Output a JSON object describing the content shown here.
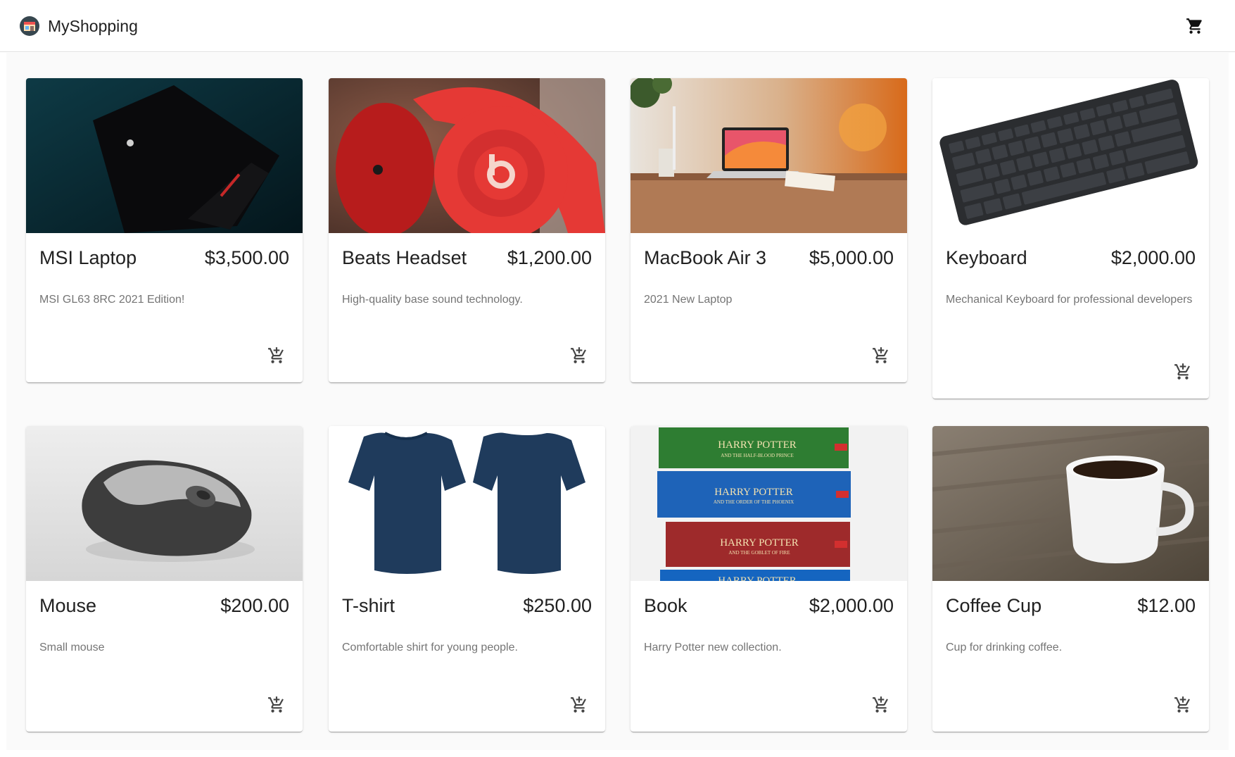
{
  "app": {
    "brand": "MyShopping",
    "logo_icon": "store-logo-icon",
    "cart_icon": "shopping-cart-icon"
  },
  "colors": {
    "background": "#fafafa",
    "appbar": "#ffffff",
    "text_primary": "#212121",
    "text_secondary": "#757575"
  },
  "products": [
    {
      "title": "MSI Laptop",
      "price": "$3,500.00",
      "description": "MSI GL63 8RC 2021 Edition!",
      "image": "laptop-image",
      "action_icon": "add-to-cart-icon"
    },
    {
      "title": "Beats Headset",
      "price": "$1,200.00",
      "description": "High-quality base sound technology.",
      "image": "headset-image",
      "action_icon": "add-to-cart-icon"
    },
    {
      "title": "MacBook Air 3",
      "price": "$5,000.00",
      "description": "2021 New Laptop",
      "image": "macbook-image",
      "action_icon": "add-to-cart-icon"
    },
    {
      "title": "Keyboard",
      "price": "$2,000.00",
      "description": "Mechanical Keyboard for professional developers",
      "image": "keyboard-image",
      "action_icon": "add-to-cart-icon"
    },
    {
      "title": "Mouse",
      "price": "$200.00",
      "description": "Small mouse",
      "image": "mouse-image",
      "action_icon": "add-to-cart-icon"
    },
    {
      "title": "T-shirt",
      "price": "$250.00",
      "description": "Comfortable shirt for young people.",
      "image": "tshirt-image",
      "action_icon": "add-to-cart-icon"
    },
    {
      "title": "Book",
      "price": "$2,000.00",
      "description": "Harry Potter new collection.",
      "image": "book-image",
      "action_icon": "add-to-cart-icon"
    },
    {
      "title": "Coffee Cup",
      "price": "$12.00",
      "description": "Cup for drinking coffee.",
      "image": "coffee-cup-image",
      "action_icon": "add-to-cart-icon"
    }
  ],
  "book_spines": [
    {
      "line1": "HARRY POTTER",
      "line2": "AND THE HALF-BLOOD PRINCE",
      "color": "#2e7d32"
    },
    {
      "line1": "HARRY POTTER",
      "line2": "AND THE ORDER OF THE PHOENIX",
      "color": "#1e63b8"
    },
    {
      "line1": "HARRY POTTER",
      "line2": "AND THE GOBLET OF FIRE",
      "color": "#9e2a2b"
    },
    {
      "line1": "HARRY POTTER",
      "line2": "",
      "color": "#1565c0"
    }
  ]
}
